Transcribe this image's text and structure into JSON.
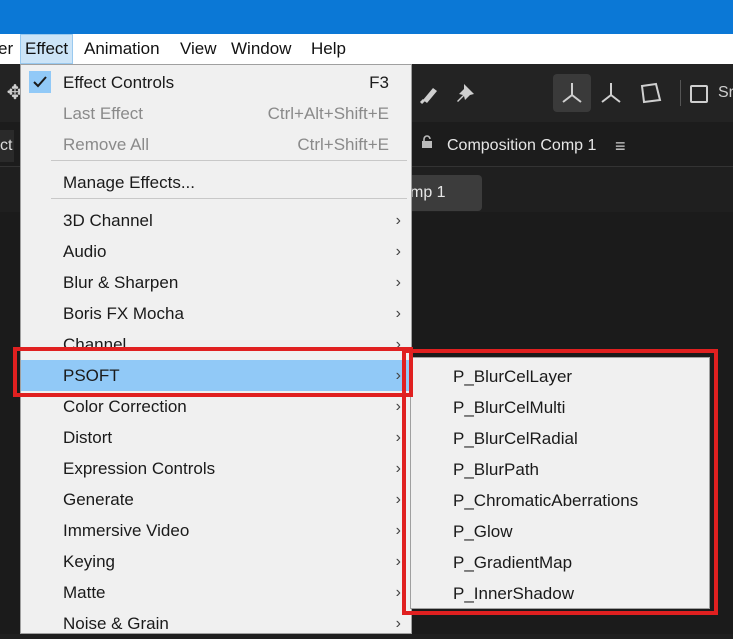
{
  "menubar": {
    "items": [
      "er",
      "Effect",
      "Animation",
      "View",
      "Window",
      "Help"
    ]
  },
  "toolbar": {
    "truncated_label": "Sr"
  },
  "panel": {
    "left_tab_truncated": "ct",
    "composition_title": "Composition Comp 1",
    "comp_tab_truncated": "mp 1"
  },
  "effect_menu": {
    "items": [
      {
        "label": "Effect Controls",
        "shortcut": "F3",
        "checked": true
      },
      {
        "label": "Last Effect",
        "shortcut": "Ctrl+Alt+Shift+E",
        "disabled": true
      },
      {
        "label": "Remove All",
        "shortcut": "Ctrl+Shift+E",
        "disabled": true
      },
      {
        "label": "Manage Effects..."
      },
      {
        "label": "3D Channel",
        "submenu": true
      },
      {
        "label": "Audio",
        "submenu": true
      },
      {
        "label": "Blur & Sharpen",
        "submenu": true
      },
      {
        "label": "Boris FX Mocha",
        "submenu": true
      },
      {
        "label": "Channel",
        "submenu": true
      },
      {
        "label": "PSOFT",
        "submenu": true,
        "highlighted": true
      },
      {
        "label": "Color Correction",
        "submenu": true
      },
      {
        "label": "Distort",
        "submenu": true
      },
      {
        "label": "Expression Controls",
        "submenu": true
      },
      {
        "label": "Generate",
        "submenu": true
      },
      {
        "label": "Immersive Video",
        "submenu": true
      },
      {
        "label": "Keying",
        "submenu": true
      },
      {
        "label": "Matte",
        "submenu": true
      },
      {
        "label": "Noise & Grain",
        "submenu": true
      }
    ],
    "arrow_glyph": "›"
  },
  "psoft_submenu": {
    "items": [
      "P_BlurCelLayer",
      "P_BlurCelMulti",
      "P_BlurCelRadial",
      "P_BlurPath",
      "P_ChromaticAberrations",
      "P_Glow",
      "P_GradientMap",
      "P_InnerShadow"
    ]
  },
  "colors": {
    "titlebar": "#0b78d6",
    "menu_highlight": "#91c9f7",
    "annotation_red": "#e02020"
  }
}
